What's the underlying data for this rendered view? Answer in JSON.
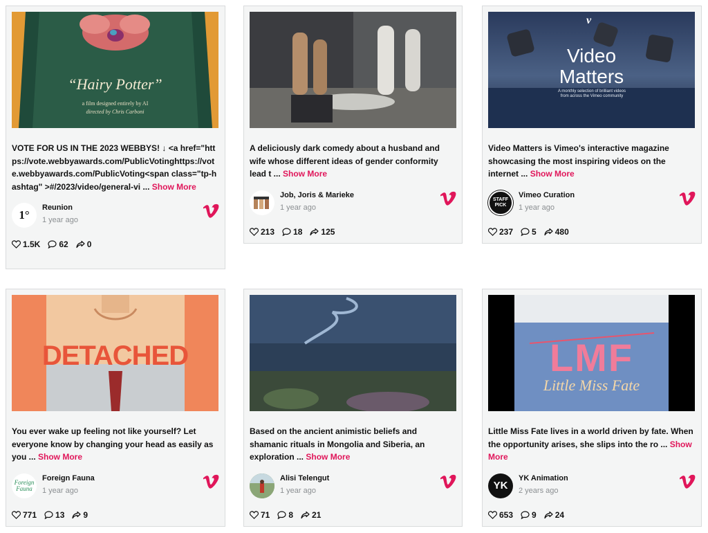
{
  "cards": [
    {
      "desc_text": "VOTE FOR US IN THE 2023 WEBBYS! ↓ <a href=\"https://vote.webbyawards.com/PublicVotinghttps://vote.webbyawards.com/PublicVoting<span class=\"tp-hashtag\" >#/2023/video/general-vi ...",
      "show_more": "Show More",
      "author": "Reunion",
      "time": "1 year ago",
      "likes": "1.5K",
      "comments": "62",
      "shares": "0",
      "thumb": {
        "title": "“Hairy Potter”",
        "sub1": "a film designed entirely by AI",
        "sub2": "directed by Chris Carboni"
      },
      "avatar_text": "1°"
    },
    {
      "desc_text": "A deliciously dark comedy about a husband and wife whose different ideas of gender conformity lead t ...",
      "show_more": "Show More",
      "author": "Job, Joris & Marieke",
      "time": "1 year ago",
      "likes": "213",
      "comments": "18",
      "shares": "125"
    },
    {
      "desc_text": "Video Matters is Vimeo's interactive magazine showcasing the most inspiring videos on the internet ...",
      "show_more": "Show More",
      "author": "Vimeo Curation",
      "time": "1 year ago",
      "likes": "237",
      "comments": "5",
      "shares": "480",
      "thumb": {
        "title1": "Video",
        "title2": "Matters",
        "sub": "A monthly selection of brilliant videos from across the Vimeo community"
      },
      "avatar_text": "STAFF PICK"
    },
    {
      "desc_text": "You ever wake up feeling not like yourself? Let everyone know by changing your head as easily as you ...",
      "show_more": "Show More",
      "author": "Foreign Fauna",
      "time": "1 year ago",
      "likes": "771",
      "comments": "13",
      "shares": "9",
      "thumb": {
        "title": "DETACHED"
      },
      "avatar_text": "Foreign Fauna"
    },
    {
      "desc_text": "Based on the ancient animistic beliefs and shamanic rituals in Mongolia and Siberia, an exploration ...",
      "show_more": "Show More",
      "author": "Alisi Telengut",
      "time": "1 year ago",
      "likes": "71",
      "comments": "8",
      "shares": "21"
    },
    {
      "desc_text": "Little Miss Fate lives in a world driven by fate. When the opportunity arises, she slips into the ro ...",
      "show_more": "Show More",
      "author": "YK Animation",
      "time": "2 years ago",
      "likes": "653",
      "comments": "9",
      "shares": "24",
      "thumb": {
        "title": "LMF",
        "script": "Little Miss Fate"
      },
      "avatar_text": "YK"
    }
  ],
  "colors": {
    "accent": "#e0165a",
    "vimeo": "#e0165a"
  }
}
